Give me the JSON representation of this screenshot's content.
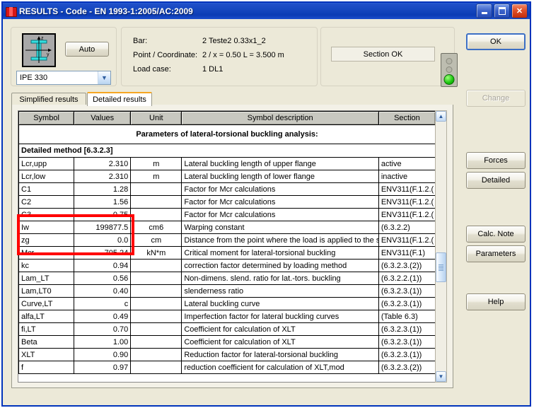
{
  "window": {
    "title": "RESULTS - Code - EN 1993-1:2005/AC:2009",
    "app_icon": "steel-section-icon",
    "minimize_label": "",
    "maximize_label": "",
    "close_label": "✕"
  },
  "section_panel": {
    "profile_icon": "i-beam-section-icon",
    "axis_z": "z",
    "axis_y": "y",
    "auto_button": "Auto",
    "combo_value": "IPE 330",
    "combo_arrow": "▼"
  },
  "info_panel": {
    "rows": [
      {
        "label": "Bar:",
        "value": "2  Teste2 0.33x1_2"
      },
      {
        "label": "Point / Coordinate:",
        "value": "2 / x = 0.50 L = 3.500 m"
      },
      {
        "label": "Load case:",
        "value": "1 DL1"
      }
    ]
  },
  "status_panel": {
    "status_text": "Section OK",
    "led_state": "green"
  },
  "tabs": [
    {
      "label": "Simplified results",
      "active": false
    },
    {
      "label": "Detailed results",
      "active": true
    }
  ],
  "table": {
    "headers": [
      "Symbol",
      "Values",
      "Unit",
      "Symbol description",
      "Section"
    ],
    "title_row": "Parameters of lateral-torsional buckling analysis:",
    "section_row": "Detailed method [6.3.2.3]",
    "rows": [
      {
        "symbol": "Lcr,upp",
        "value": "2.310",
        "unit": "m",
        "description": "Lateral buckling length of upper flange",
        "section": "active"
      },
      {
        "symbol": "Lcr,low",
        "value": "2.310",
        "unit": "m",
        "description": "Lateral buckling length of lower flange",
        "section": "inactive"
      },
      {
        "symbol": "C1",
        "value": "1.28",
        "unit": "",
        "description": "Factor for Mcr calculations",
        "section": "ENV311(F.1.2.("
      },
      {
        "symbol": "C2",
        "value": "1.56",
        "unit": "",
        "description": "Factor for Mcr calculations",
        "section": "ENV311(F.1.2.("
      },
      {
        "symbol": "C3",
        "value": "0.75",
        "unit": "",
        "description": "Factor for Mcr calculations",
        "section": "ENV311(F.1.2.("
      },
      {
        "symbol": "Iw",
        "value": "199877.5",
        "unit": "cm6",
        "description": "Warping constant",
        "section": "(6.3.2.2)"
      },
      {
        "symbol": "zg",
        "value": "0.0",
        "unit": "cm",
        "description": "Distance from the point where the load is applied to the s",
        "section": "ENV311(F.1.2.("
      },
      {
        "symbol": "Mcr",
        "value": "705.24",
        "unit": "kN*m",
        "description": "Critical moment for lateral-torsional buckling",
        "section": "ENV311(F.1)"
      },
      {
        "symbol": "kc",
        "value": "0.94",
        "unit": "",
        "description": "correction factor determined by loading method",
        "section": "(6.3.2.3.(2))"
      },
      {
        "symbol": "Lam_LT",
        "value": "0.56",
        "unit": "",
        "description": "Non-dimens. slend. ratio for lat.-tors. buckling",
        "section": "(6.3.2.2.(1))"
      },
      {
        "symbol": "Lam,LT0",
        "value": "0.40",
        "unit": "",
        "description": "slenderness ratio",
        "section": "(6.3.2.3.(1))"
      },
      {
        "symbol": "Curve,LT",
        "value": "c",
        "unit": "",
        "description": "Lateral buckling curve",
        "section": "(6.3.2.3.(1))"
      },
      {
        "symbol": "alfa,LT",
        "value": "0.49",
        "unit": "",
        "description": "Imperfection factor for lateral buckling curves",
        "section": "(Table 6.3)"
      },
      {
        "symbol": "fi,LT",
        "value": "0.70",
        "unit": "",
        "description": "Coefficient for calculation of XLT",
        "section": "(6.3.2.3.(1))"
      },
      {
        "symbol": "Beta",
        "value": "1.00",
        "unit": "",
        "description": "Coefficient for calculation of XLT",
        "section": "(6.3.2.3.(1))"
      },
      {
        "symbol": "XLT",
        "value": "0.90",
        "unit": "",
        "description": "Reduction factor for lateral-torsional buckling",
        "section": "(6.3.2.3.(1))"
      },
      {
        "symbol": "f",
        "value": "0.97",
        "unit": "",
        "description": "reduction coefficient for calculation of XLT,mod",
        "section": "(6.3.2.3.(2))"
      }
    ]
  },
  "scrollbar": {
    "up_arrow": "▲",
    "down_arrow": "▼"
  },
  "annotation": {
    "highlight_color": "#ff0000",
    "highlight_rows": [
      "C1",
      "C2",
      "C3"
    ]
  },
  "buttons": {
    "ok": "OK",
    "change": "Change",
    "forces": "Forces",
    "detailed": "Detailed",
    "calc_note": "Calc. Note",
    "parameters": "Parameters",
    "help": "Help"
  }
}
